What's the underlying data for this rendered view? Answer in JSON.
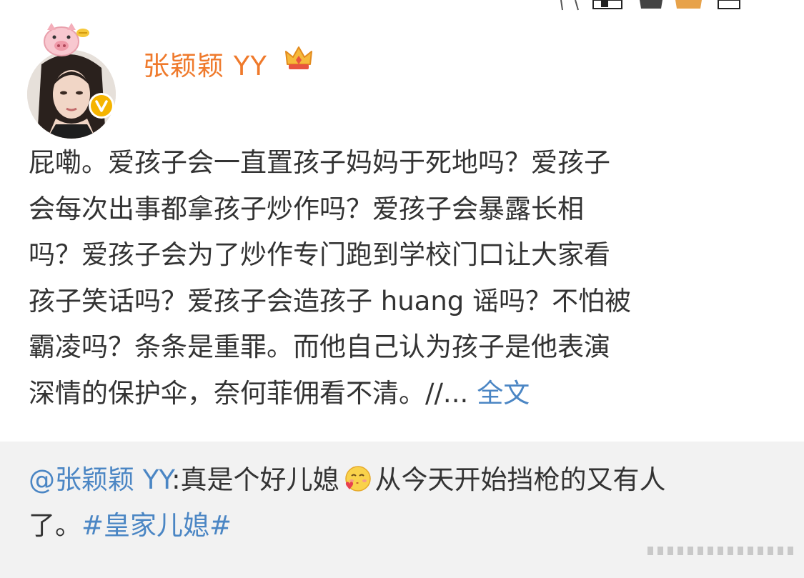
{
  "post": {
    "author": "张颖颖 YY",
    "text_lines": [
      "屁嘞。爱孩子会一直置孩子妈妈于死地吗？爱孩子",
      "会每次出事都拿孩子炒作吗？爱孩子会暴露长相",
      "吗？爱孩子会为了炒作专门跑到学校门口让大家看",
      "孩子笑话吗？爱孩子会造孩子 huang 谣吗？不怕被",
      "霸凌吗？条条是重罪。而他自己认为孩子是他表演",
      "深情的保护伞，奈何菲佣看不清。//..."
    ],
    "full_text_link": "全文"
  },
  "repost": {
    "mention": "@张颖颖 YY",
    "text_before_emoji": ":真是个好儿媳",
    "text_after_emoji": "从今天开始挡枪的又有人",
    "line2_text": "了。",
    "hashtag": "#皇家儿媳#"
  },
  "icons": {
    "avatar_badge": "pig-icon",
    "verified": "verified-icon",
    "member": "crown-icon",
    "emoji": "kissing-heart-emoji"
  },
  "colors": {
    "username": "#ef7a2c",
    "link": "#4b86c4",
    "repost_bg": "#f2f2f2",
    "verified": "#f5b400"
  }
}
